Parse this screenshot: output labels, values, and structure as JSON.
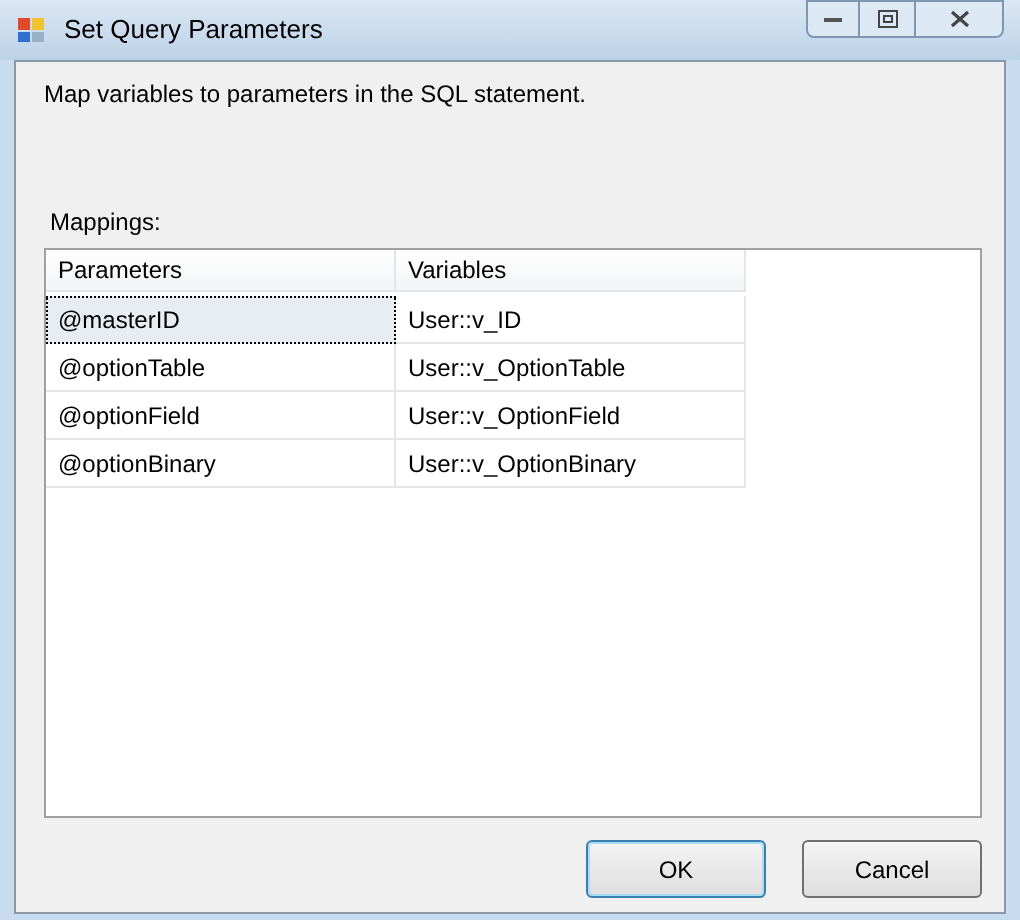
{
  "window": {
    "title": "Set Query Parameters"
  },
  "description": "Map variables to parameters in the SQL statement.",
  "mappings": {
    "label": "Mappings:",
    "columns": [
      "Parameters",
      "Variables"
    ],
    "rows": [
      {
        "cells": [
          "@masterID",
          "User::v_ID"
        ],
        "selected": true
      },
      {
        "cells": [
          "@optionTable",
          "User::v_OptionTable"
        ],
        "selected": false
      },
      {
        "cells": [
          "@optionField",
          "User::v_OptionField"
        ],
        "selected": false
      },
      {
        "cells": [
          "@optionBinary",
          "User::v_OptionBinary"
        ],
        "selected": false
      }
    ]
  },
  "buttons": [
    {
      "label": "OK",
      "default": true
    },
    {
      "label": "Cancel",
      "default": false
    }
  ]
}
